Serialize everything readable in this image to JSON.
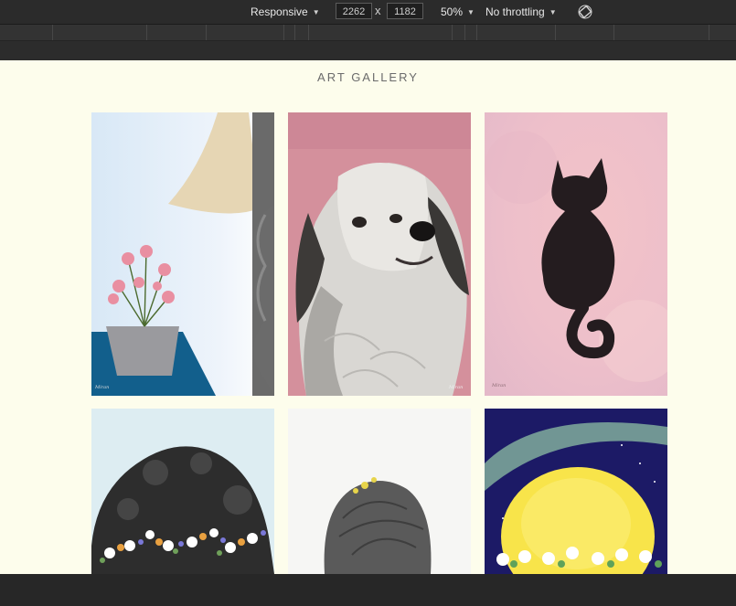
{
  "devtools": {
    "device_mode": "Responsive",
    "width_value": "2262",
    "times_symbol": "x",
    "height_value": "1182",
    "zoom": "50%",
    "throttling": "No throttling",
    "rotate_icon": "rotate-icon"
  },
  "page": {
    "background": "#fdfdec",
    "title": "ART GALLERY",
    "artworks": [
      {
        "subject": "flowers-lamp-painting",
        "signature": "Miran"
      },
      {
        "subject": "dog-painting",
        "signature": "Miran"
      },
      {
        "subject": "black-cat-painting",
        "signature": "Miran"
      },
      {
        "subject": "flower-crown-dark-hair-painting"
      },
      {
        "subject": "girl-back-hair-painting"
      },
      {
        "subject": "yellow-moon-flowers-painting"
      }
    ]
  }
}
